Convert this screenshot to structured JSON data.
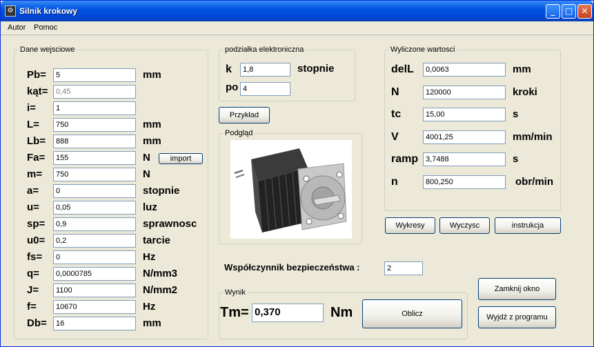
{
  "window": {
    "title": "Silnik krokowy"
  },
  "menu": {
    "items": [
      "Autor",
      "Pomoc"
    ]
  },
  "inputs": {
    "legend": "Dane wejsciowe",
    "rows": [
      {
        "label": "Pb=",
        "value": "5",
        "unit": "mm",
        "disabled": false
      },
      {
        "label": "kąt=",
        "value": "0,45",
        "unit": "",
        "disabled": true
      },
      {
        "label": "i=",
        "value": "1",
        "unit": "",
        "disabled": false
      },
      {
        "label": "L=",
        "value": "750",
        "unit": "mm",
        "disabled": false
      },
      {
        "label": "Lb=",
        "value": "888",
        "unit": "mm",
        "disabled": false
      },
      {
        "label": "Fa=",
        "value": "155",
        "unit": "N",
        "disabled": false
      },
      {
        "label": "m=",
        "value": "750",
        "unit": "N",
        "disabled": false
      },
      {
        "label": "a=",
        "value": "0",
        "unit": "stopnie",
        "disabled": false
      },
      {
        "label": "u=",
        "value": "0,05",
        "unit": "luz",
        "disabled": false
      },
      {
        "label": "sp=",
        "value": "0,9",
        "unit": "sprawnosc",
        "disabled": false
      },
      {
        "label": "u0=",
        "value": "0,2",
        "unit": "tarcie",
        "disabled": false
      },
      {
        "label": "fs=",
        "value": "0",
        "unit": "Hz",
        "disabled": false
      },
      {
        "label": "q=",
        "value": "0,0000785",
        "unit": "N/mm3",
        "disabled": false
      },
      {
        "label": "J=",
        "value": "1100",
        "unit": "N/mm2",
        "disabled": false
      },
      {
        "label": "f=",
        "value": "10670",
        "unit": "Hz",
        "disabled": false
      },
      {
        "label": "Db=",
        "value": "16",
        "unit": "mm",
        "disabled": false
      }
    ],
    "import_label": "import"
  },
  "podzialka": {
    "legend": "podziałka elektroniczna",
    "k_label": "k",
    "k_value": "1,8",
    "k_unit": "stopnie",
    "po_label": "po",
    "po_value": "4"
  },
  "przyklad_label": "Przykład",
  "podglad": {
    "legend": "Podgląd"
  },
  "outputs": {
    "legend": "Wyliczone wartosci",
    "rows": [
      {
        "label": "delL",
        "value": "0,0063",
        "unit": "mm"
      },
      {
        "label": "N",
        "value": "120000",
        "unit": "kroki"
      },
      {
        "label": "tc",
        "value": "15,00",
        "unit": "s"
      },
      {
        "label": "V",
        "value": "4001,25",
        "unit": "mm/min"
      },
      {
        "label": "ramp",
        "value": "3,7488",
        "unit": "s"
      },
      {
        "label": "n",
        "value": "800,250",
        "unit": "obr/min"
      }
    ]
  },
  "buttons": {
    "wykresy": "Wykresy",
    "wyczysc": "Wyczysc",
    "instrukcja": "instrukcja",
    "zamknij": "Zamknij okno",
    "wyjdz": "Wyjdź z programu",
    "oblicz": "Oblicz"
  },
  "safety": {
    "label": "Współczynnik bezpieczeństwa :",
    "value": "2"
  },
  "wynik": {
    "legend": "Wynik",
    "label": "Tm=",
    "value": "0,370",
    "unit": "Nm"
  }
}
